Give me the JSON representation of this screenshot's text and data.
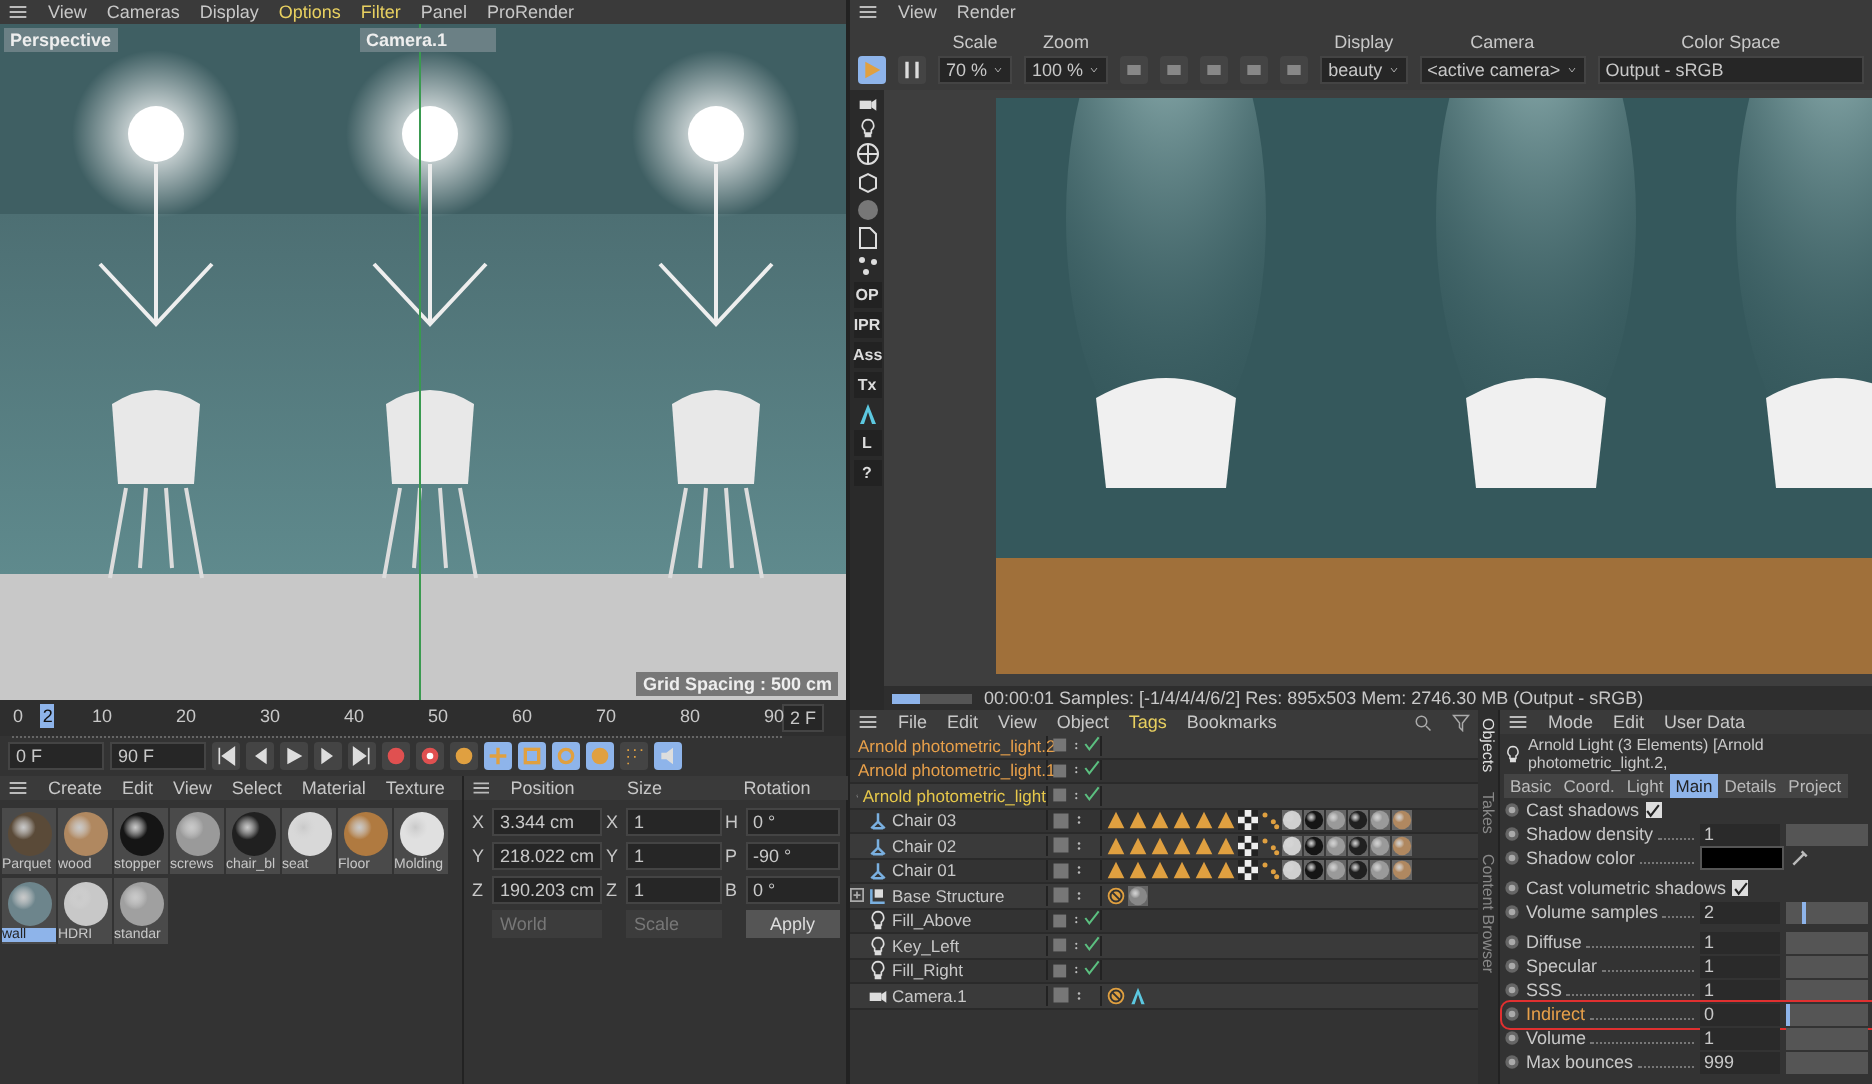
{
  "viewport": {
    "menu": [
      {
        "label": "View",
        "highlighted": false
      },
      {
        "label": "Cameras",
        "highlighted": false
      },
      {
        "label": "Display",
        "highlighted": false
      },
      {
        "label": "Options",
        "highlighted": true
      },
      {
        "label": "Filter",
        "highlighted": true
      },
      {
        "label": "Panel",
        "highlighted": false
      },
      {
        "label": "ProRender",
        "highlighted": false
      }
    ],
    "view_name": "Perspective",
    "camera": "Camera.1",
    "grid_spacing": "Grid Spacing : 500 cm"
  },
  "timeline": {
    "ticks": [
      "0",
      "10",
      "20",
      "30",
      "40",
      "50",
      "60",
      "70",
      "80",
      "90"
    ],
    "level": 0.022,
    "marker": "2",
    "current": "2 F",
    "start": "0 F",
    "end": "90 F"
  },
  "materials": {
    "menu": [
      "Create",
      "Edit",
      "View",
      "Select",
      "Material",
      "Texture"
    ],
    "items": [
      {
        "name": "Parquet",
        "color": "#5a4a38",
        "selected": false
      },
      {
        "name": "wood",
        "color": "#b08860",
        "selected": false
      },
      {
        "name": "stopper",
        "color": "#151515",
        "selected": false
      },
      {
        "name": "screws",
        "color": "#9a9a9a",
        "selected": false
      },
      {
        "name": "chair_bl",
        "color": "#202020",
        "selected": false
      },
      {
        "name": "seat",
        "color": "#d8d8d8",
        "selected": false
      },
      {
        "name": "Floor",
        "color": "#b07a40",
        "selected": false
      },
      {
        "name": "Molding",
        "color": "#e0e0e0",
        "selected": false
      },
      {
        "name": "wall",
        "color": "#6d858c",
        "selected": true
      },
      {
        "name": "HDRI",
        "color": "#c8c8c8",
        "selected": false
      },
      {
        "name": "standar",
        "color": "#a0a0a0",
        "selected": false
      }
    ]
  },
  "coordinates": {
    "headers": [
      "Position",
      "Size",
      "Rotation"
    ],
    "rows": [
      [
        "X",
        "3.344 cm",
        "X",
        "1",
        "H",
        "0 °"
      ],
      [
        "Y",
        "218.022 cm",
        "Y",
        "1",
        "P",
        "-90 °"
      ],
      [
        "Z",
        "190.203 cm",
        "Z",
        "1",
        "B",
        "0 °"
      ]
    ],
    "mode": "World",
    "size_mode": "Scale",
    "apply": "Apply"
  },
  "render": {
    "menu": [
      "View",
      "Render"
    ],
    "playing": true,
    "scale_label": "Scale",
    "scale": "70 %",
    "zoom_label": "Zoom",
    "zoom": "100 %",
    "display_label": "Display",
    "display": "beauty",
    "camera_label": "Camera",
    "camera": "<active camera>",
    "color_space_label": "Color Space",
    "color_space": "Output - sRGB",
    "side_texts": [
      "OP",
      "IPR",
      "Ass",
      "Tx",
      "L",
      "?"
    ],
    "progress": {
      "level": 0.35
    },
    "status": "00:00:01 Samples: [-1/4/4/4/6/2] Res: 895x503 Mem: 2746.30 MB (Output - sRGB)"
  },
  "objects": {
    "menu": [
      {
        "label": "File",
        "highlighted": false
      },
      {
        "label": "Edit",
        "highlighted": false
      },
      {
        "label": "View",
        "highlighted": false
      },
      {
        "label": "Object",
        "highlighted": false
      },
      {
        "label": "Tags",
        "highlighted": true
      },
      {
        "label": "Bookmarks",
        "highlighted": false
      }
    ],
    "rows": [
      {
        "name": "Arnold photometric_light.2",
        "kind": "light",
        "selected": true,
        "active": false,
        "check": true,
        "tags": []
      },
      {
        "name": "Arnold photometric_light.1",
        "kind": "light",
        "selected": true,
        "active": false,
        "check": true,
        "tags": []
      },
      {
        "name": "Arnold photometric_light",
        "kind": "light",
        "selected": true,
        "active": true,
        "check": true,
        "tags": []
      },
      {
        "name": "Chair 03",
        "kind": "chair",
        "selected": false,
        "active": false,
        "check": false,
        "tags": [
          {
            "kind": "cone"
          },
          {
            "kind": "cone"
          },
          {
            "kind": "cone"
          },
          {
            "kind": "cone"
          },
          {
            "kind": "cone"
          },
          {
            "kind": "cone"
          },
          {
            "kind": "checker"
          },
          {
            "kind": "dots"
          },
          {
            "kind": "sphere",
            "color": "#d0d0d0"
          },
          {
            "kind": "sphere",
            "color": "#151515"
          },
          {
            "kind": "sphere",
            "color": "#9a9a9a"
          },
          {
            "kind": "sphere",
            "color": "#202020"
          },
          {
            "kind": "sphere",
            "color": "#9a9a9a"
          },
          {
            "kind": "sphere",
            "color": "#b08860"
          }
        ]
      },
      {
        "name": "Chair 02",
        "kind": "chair",
        "selected": false,
        "active": false,
        "check": false,
        "tags": [
          {
            "kind": "cone"
          },
          {
            "kind": "cone"
          },
          {
            "kind": "cone"
          },
          {
            "kind": "cone"
          },
          {
            "kind": "cone"
          },
          {
            "kind": "cone"
          },
          {
            "kind": "checker"
          },
          {
            "kind": "dots"
          },
          {
            "kind": "sphere",
            "color": "#d0d0d0"
          },
          {
            "kind": "sphere",
            "color": "#151515"
          },
          {
            "kind": "sphere",
            "color": "#9a9a9a"
          },
          {
            "kind": "sphere",
            "color": "#202020"
          },
          {
            "kind": "sphere",
            "color": "#9a9a9a"
          },
          {
            "kind": "sphere",
            "color": "#b08860"
          }
        ]
      },
      {
        "name": "Chair 01",
        "kind": "chair",
        "selected": false,
        "active": false,
        "check": false,
        "tags": [
          {
            "kind": "cone"
          },
          {
            "kind": "cone"
          },
          {
            "kind": "cone"
          },
          {
            "kind": "cone"
          },
          {
            "kind": "cone"
          },
          {
            "kind": "cone"
          },
          {
            "kind": "checker"
          },
          {
            "kind": "dots"
          },
          {
            "kind": "sphere",
            "color": "#d0d0d0"
          },
          {
            "kind": "sphere",
            "color": "#151515"
          },
          {
            "kind": "sphere",
            "color": "#9a9a9a"
          },
          {
            "kind": "sphere",
            "color": "#202020"
          },
          {
            "kind": "sphere",
            "color": "#9a9a9a"
          },
          {
            "kind": "sphere",
            "color": "#b08860"
          }
        ]
      },
      {
        "name": "Base Structure",
        "kind": "null",
        "selected": false,
        "active": false,
        "check": false,
        "expanded": false,
        "tags": [
          {
            "kind": "forbid"
          },
          {
            "kind": "sphere",
            "color": "#888888"
          }
        ]
      },
      {
        "name": "Fill_Above",
        "kind": "light",
        "selected": false,
        "active": false,
        "check": true,
        "tags": []
      },
      {
        "name": "Key_Left",
        "kind": "light",
        "selected": false,
        "active": false,
        "check": true,
        "tags": []
      },
      {
        "name": "Fill_Right",
        "kind": "light",
        "selected": false,
        "active": false,
        "check": true,
        "tags": []
      },
      {
        "name": "Camera.1",
        "kind": "camera",
        "selected": false,
        "active": false,
        "check": false,
        "tags": [
          {
            "kind": "forbid"
          },
          {
            "kind": "arnold"
          }
        ]
      }
    ],
    "side_tabs": [
      {
        "label": "Objects",
        "selected": true
      },
      {
        "label": "Takes",
        "selected": false
      },
      {
        "label": "Content Browser",
        "selected": false
      }
    ]
  },
  "attributes": {
    "menu": [
      "Mode",
      "Edit",
      "User Data"
    ],
    "title": "Arnold Light (3 Elements) [Arnold photometric_light.2,",
    "tabs": [
      {
        "label": "Basic",
        "selected": false
      },
      {
        "label": "Coord.",
        "selected": false
      },
      {
        "label": "Light",
        "selected": false
      },
      {
        "label": "Main",
        "selected": true
      },
      {
        "label": "Details",
        "selected": false
      },
      {
        "label": "Project",
        "selected": false
      }
    ],
    "params": [
      {
        "kind": "checkbox",
        "label": "Cast shadows",
        "checked": true,
        "highlighted": false
      },
      {
        "kind": "number",
        "label": "Shadow density",
        "value": "1",
        "highlighted": false
      },
      {
        "kind": "color",
        "label": "Shadow color",
        "color": "#000000",
        "highlighted": false
      },
      {
        "kind": "checkbox",
        "label": "Cast volumetric shadows",
        "checked": true,
        "highlighted": false
      },
      {
        "kind": "slider",
        "label": "Volume samples",
        "value": "2",
        "level": 0.2,
        "highlighted": false
      },
      {
        "kind": "number",
        "label": "Diffuse",
        "value": "1",
        "highlighted": false
      },
      {
        "kind": "number",
        "label": "Specular",
        "value": "1",
        "highlighted": false
      },
      {
        "kind": "number",
        "label": "SSS",
        "value": "1",
        "highlighted": false
      },
      {
        "kind": "slider",
        "label": "Indirect",
        "value": "0",
        "level": 0,
        "highlighted": true
      },
      {
        "kind": "number",
        "label": "Volume",
        "value": "1",
        "highlighted": false
      },
      {
        "kind": "number",
        "label": "Max bounces",
        "value": "999",
        "highlighted": false
      }
    ]
  }
}
